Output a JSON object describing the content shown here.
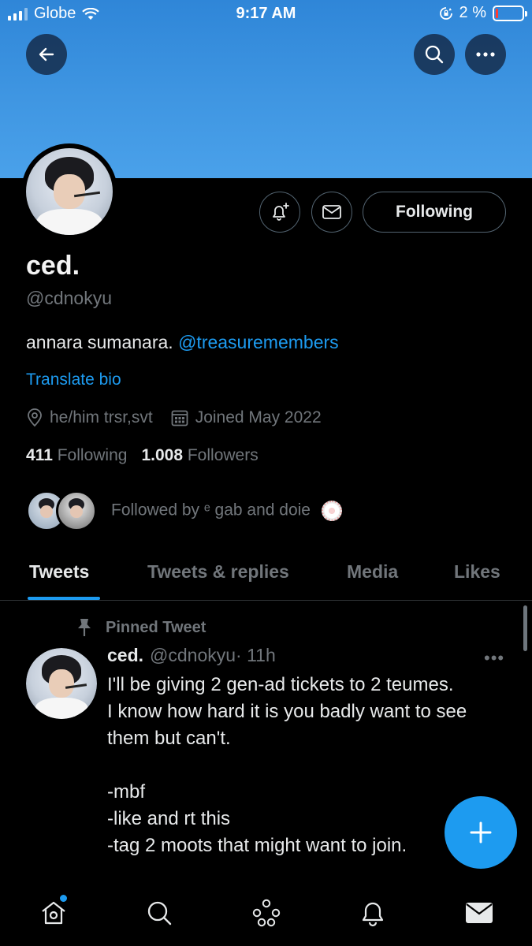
{
  "status_bar": {
    "carrier": "Globe",
    "time": "9:17 AM",
    "battery_percent": "2 %",
    "battery_level": 0.02
  },
  "header": {
    "back_icon": "arrow-left-icon",
    "search_icon": "search-icon",
    "more_icon": "more-horizontal-icon",
    "banner_color": "#3f96e2"
  },
  "profile": {
    "display_name": "ced.",
    "handle": "@cdnokyu",
    "bio_text": "annara sumanara.",
    "bio_mention": "@treasuremembers",
    "translate_label": "Translate bio",
    "location": "he/him trsr,svt",
    "joined": "Joined May 2022",
    "following_count": "411",
    "following_label": "Following",
    "followers_count": "1.008",
    "followers_label": "Followers",
    "follow_button": "Following",
    "followed_by_prefix": "Followed by",
    "followed_by_names": "ᵉ gab and doie"
  },
  "tabs": [
    {
      "label": "Tweets",
      "active": true
    },
    {
      "label": "Tweets & replies",
      "active": false
    },
    {
      "label": "Media",
      "active": false
    },
    {
      "label": "Likes",
      "active": false
    }
  ],
  "pinned_tweet": {
    "pinned_label": "Pinned Tweet",
    "author": "ced.",
    "handle": "@cdnokyu",
    "time": "· 11h",
    "more": "•••",
    "lines": [
      "I'll be giving 2 gen-ad tickets to 2 teumes.",
      "I know how hard it is you badly want to see",
      "them but can't."
    ],
    "lines2": [
      "-mbf",
      "-like and rt this",
      "-tag 2 moots that might want to join."
    ]
  },
  "bottom_nav": [
    "home-icon",
    "search-icon",
    "spaces-icon",
    "notifications-icon",
    "messages-icon"
  ],
  "colors": {
    "accent": "#1d9bf0",
    "secondary_text": "#71767b",
    "background": "#000000"
  }
}
